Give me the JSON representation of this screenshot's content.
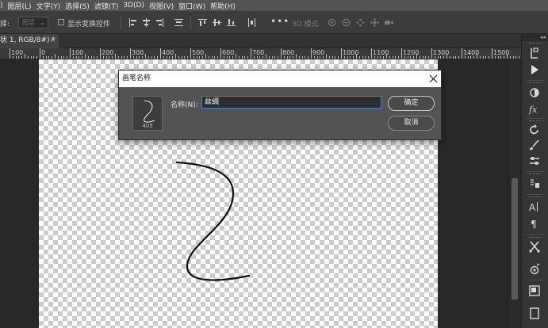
{
  "menu": {
    "items": [
      ")",
      "图层(L)",
      "文字(Y)",
      "选择(S)",
      "滤镜(T)",
      "3D(D)",
      "视图(V)",
      "窗口(W)",
      "帮助(H)"
    ]
  },
  "options": {
    "select_label": "择:",
    "select_value": "图层",
    "checkbox_label": "显示变换控件",
    "mode3d_label": "3D 模式:",
    "more_label": "•••"
  },
  "document_tab": {
    "title": "状 1, RGB/8#) *",
    "close": "×"
  },
  "ruler": {
    "labels": [
      "100",
      "0",
      "100",
      "200",
      "300",
      "400",
      "500",
      "600",
      "700",
      "800",
      "900",
      "1000",
      "1100",
      "1200",
      "1300",
      "1400",
      "1500"
    ]
  },
  "panel": {
    "collapse": "◂◂"
  },
  "dialog": {
    "title": "画笔名称",
    "preview_size": "405",
    "name_label": "名称(N):",
    "name_value": "丝绸",
    "ok_label": "确定",
    "cancel_label": "取消"
  },
  "colors": {
    "accent": "#3f7fd4",
    "menubar": "#535353",
    "dialog_bg": "#535353"
  }
}
